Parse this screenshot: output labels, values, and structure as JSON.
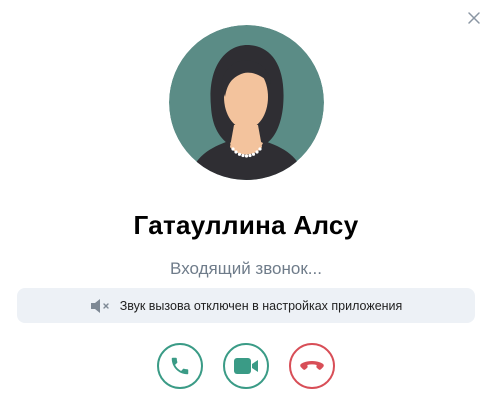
{
  "caller": {
    "name": "Гатауллина Алсу",
    "status": "Входящий звонок..."
  },
  "notice": {
    "text": "Звук вызова отключен в настройках приложения",
    "icon": "speaker-muted-icon"
  },
  "actions": {
    "accept": {
      "icon": "phone-icon",
      "color": "#3a9b86"
    },
    "video": {
      "icon": "video-camera-icon",
      "color": "#3a9b86"
    },
    "decline": {
      "icon": "phone-hangup-icon",
      "color": "#d84e57"
    }
  },
  "colors": {
    "avatar_bg": "#5b8c86",
    "notice_bg": "#edf1f6",
    "status_text": "#6f7c8a"
  }
}
